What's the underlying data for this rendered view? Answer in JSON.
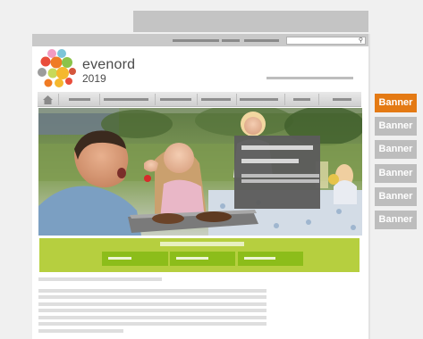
{
  "brand": {
    "name": "evenord",
    "year": "2019",
    "logo_colors": [
      "#f07b24",
      "#8bc34a",
      "#e94d3b",
      "#f5b82e",
      "#7cc5d8",
      "#9c9c9c",
      "#f29bc1",
      "#c7d95a",
      "#d4563c"
    ]
  },
  "side_banners": {
    "items": [
      {
        "label": "Banner",
        "color": "#e47a14",
        "active": true
      },
      {
        "label": "Banner",
        "color": "#bdbdbd",
        "active": false
      },
      {
        "label": "Banner",
        "color": "#bdbdbd",
        "active": false
      },
      {
        "label": "Banner",
        "color": "#bdbdbd",
        "active": false
      },
      {
        "label": "Banner",
        "color": "#bdbdbd",
        "active": false
      },
      {
        "label": "Banner",
        "color": "#bdbdbd",
        "active": false
      }
    ]
  },
  "nav": {
    "home_icon": "home-icon"
  },
  "search": {
    "icon": "search-icon"
  },
  "colors": {
    "accent_orange": "#e47a14",
    "green_panel": "#b6cf3f",
    "green_button": "#8cbd1a",
    "placeholder_gray": "#c4c4c4",
    "overlay_gray": "#5c5c5c"
  }
}
